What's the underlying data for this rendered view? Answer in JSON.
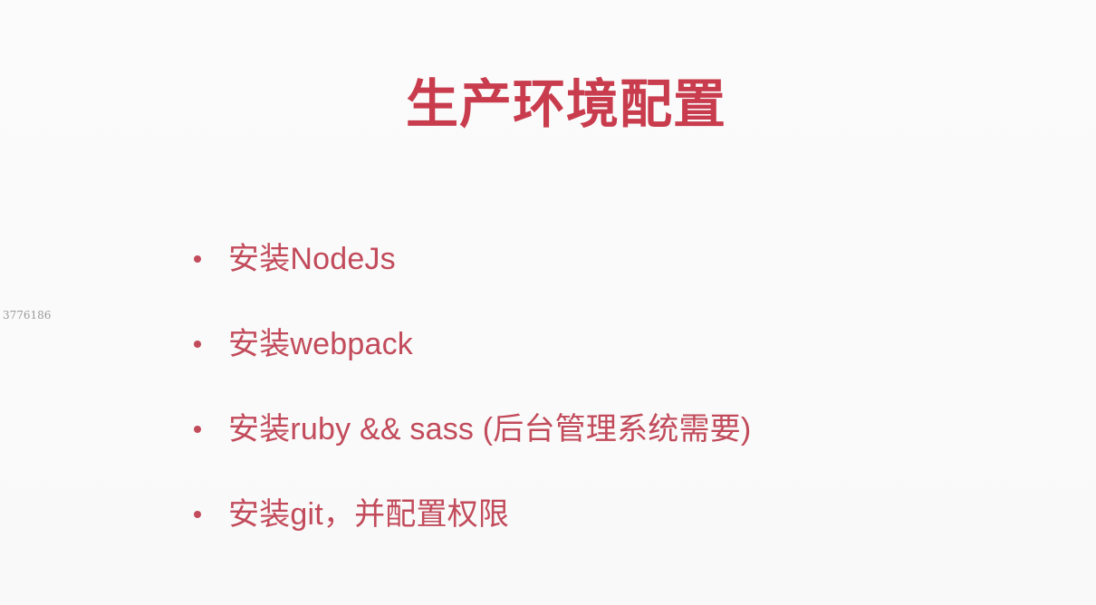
{
  "slide": {
    "title": "生产环境配置",
    "side_id": "3776186",
    "bullets": [
      "安装NodeJs",
      "安装webpack",
      "安装ruby && sass (后台管理系统需要)",
      "安装git，并配置权限"
    ],
    "colors": {
      "title": "#c83c4d",
      "bullet": "#c24b5b",
      "background": "#fbfbfb",
      "side_id": "#9b9b9b"
    }
  }
}
